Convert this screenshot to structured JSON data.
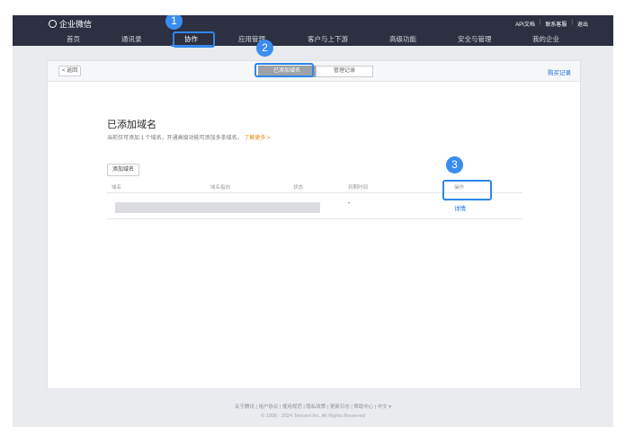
{
  "header": {
    "logo_text": "企业微信",
    "links": [
      "API文档",
      "联系客服",
      "退出"
    ],
    "nav": [
      "首页",
      "通讯录",
      "协作",
      "应用管理",
      "客户与上下游",
      "高级功能",
      "安全与管理",
      "我的企业"
    ],
    "active_nav_index": 2
  },
  "subbar": {
    "back_label": "< 返回",
    "tabs": [
      "已添加域名",
      "管理记录"
    ],
    "active_tab": 0,
    "buy_label": "购买记录"
  },
  "section": {
    "title": "已添加域名",
    "desc": "当前仅可添加 1 个域名，开通高级功能可添加多条域名。",
    "learn_more": "了解更多 >",
    "add_button": "添加域名"
  },
  "table": {
    "columns": [
      "域名",
      "域名指向",
      "状态",
      "到期时间",
      "操作"
    ],
    "rows": [
      {
        "date": "-",
        "action": "详情"
      }
    ]
  },
  "footer": {
    "links": "关于腾讯  |  用户协议  |  使用规范  |  隐私政策  |  更新日志  |  帮助中心  |  中文 ▾",
    "copyright": "© 1998 - 2024 Tencent Inc. All Rights Reserved"
  },
  "annotations": {
    "badges": [
      "1",
      "2",
      "3"
    ],
    "color": "#3a8df0"
  }
}
